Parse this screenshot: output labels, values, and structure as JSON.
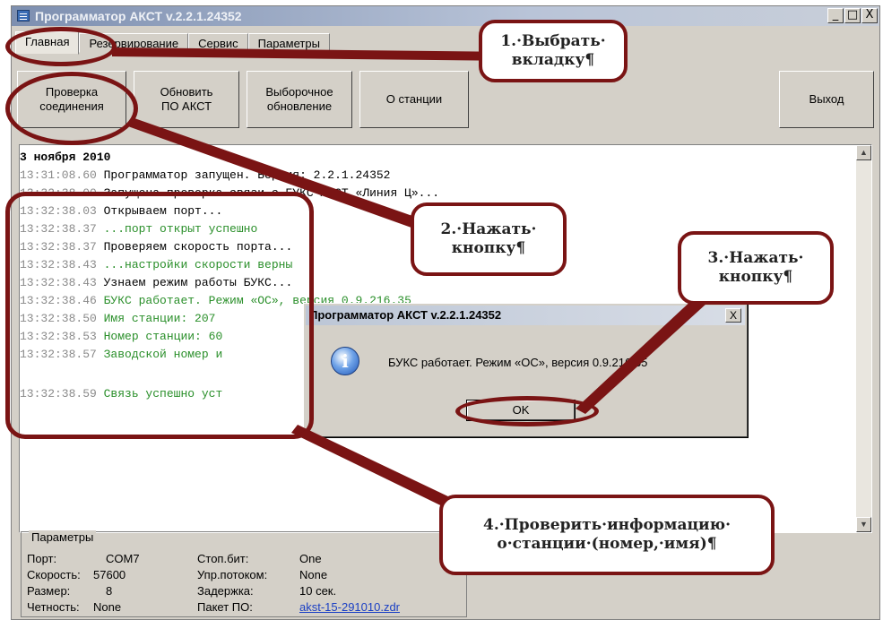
{
  "window": {
    "title": "Программатор АКСТ v.2.2.1.24352",
    "controls": {
      "minimize": "_",
      "maximize": "□",
      "close": "X"
    }
  },
  "tabs": [
    {
      "label": "Главная",
      "active": true
    },
    {
      "label": "Резервирование",
      "active": false
    },
    {
      "label": "Сервис",
      "active": false
    },
    {
      "label": "Параметры",
      "active": false
    }
  ],
  "toolbar": {
    "check_connection": "Проверка\nсоединения",
    "update_akst": "Обновить\nПО АКСТ",
    "selective_update": "Выборочное\nобновление",
    "about_station": "О станции",
    "exit": "Выход"
  },
  "log": {
    "date": "3 ноября 2010",
    "lines": [
      {
        "time": "13:31:08.60",
        "text": " Программатор запущен. Версия: 2.2.1.24352",
        "color": "black"
      },
      {
        "time": "13:32:38.00",
        "text": " Запущена проверка связи с БУКС АКСТ «Линия Ц»...",
        "color": "black"
      },
      {
        "time": "13:32:38.03",
        "text": " Открываем порт...",
        "color": "black"
      },
      {
        "time": "13:32:38.37",
        "text": " ...порт открыт успешно",
        "color": "green"
      },
      {
        "time": "13:32:38.37",
        "text": " Проверяем скорость порта...",
        "color": "black"
      },
      {
        "time": "13:32:38.43",
        "text": " ...настройки скорости верны",
        "color": "green"
      },
      {
        "time": "13:32:38.43",
        "text": " Узнаем режим работы БУКС...",
        "color": "black"
      },
      {
        "time": "13:32:38.46",
        "text": " БУКС работает. Режим «ОС», версия 0.9.216.35",
        "color": "green"
      },
      {
        "time": "13:32:38.50",
        "text": " Имя станции: 207",
        "color": "green"
      },
      {
        "time": "13:32:38.53",
        "text": " Номер станции: 60",
        "color": "green"
      },
      {
        "time": "13:32:38.57",
        "text": " Заводской номер и",
        "color": "green"
      },
      {
        "time": "13:32:38.59",
        "text": " Связь успешно уст",
        "color": "green"
      }
    ]
  },
  "scroll": {
    "up": "▲",
    "down": "▼"
  },
  "params": {
    "legend": "Параметры",
    "port_label": "Порт:",
    "port_value": "COM7",
    "speed_label": "Скорость:",
    "speed_value": "57600",
    "size_label": "Размер:",
    "size_value": "8",
    "parity_label": "Четность:",
    "parity_value": "None",
    "stopbit_label": "Стоп.бит:",
    "stopbit_value": "One",
    "flow_label": "Упр.потоком:",
    "flow_value": "None",
    "delay_label": "Задержка:",
    "delay_value": "10 сек.",
    "packet_label": "Пакет ПО:",
    "packet_value": "akst-15-291010.zdr"
  },
  "dialog": {
    "title": "Программатор АКСТ v.2.2.1.24352",
    "close": "X",
    "icon": "info-icon",
    "icon_glyph": "i",
    "message": "БУКС работает. Режим «ОС», версия 0.9.216.35",
    "ok_label": "OK"
  },
  "callouts": {
    "step1": "1.·Выбрать·\nвкладку¶",
    "step2": "2.·Нажать·\nкнопку¶",
    "step3": "3.·Нажать·\nкнопку¶",
    "step4": "4.·Проверить·информацию·\nо·станции·(номер,·имя)¶"
  },
  "colors": {
    "annotation": "#7a1414",
    "log_green": "#2a8f2a",
    "link": "#1a3fc4"
  }
}
